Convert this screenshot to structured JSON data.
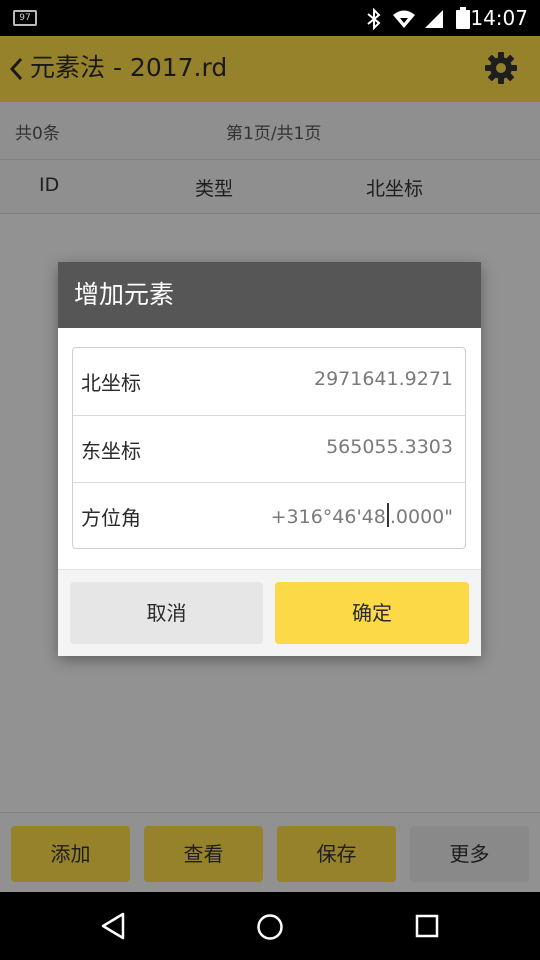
{
  "status_bar": {
    "notification_badge": "97",
    "time": "14:07",
    "icons": [
      "bluetooth-icon",
      "wifi-icon",
      "signal-icon",
      "battery-icon"
    ]
  },
  "app_bar": {
    "title": "元素法 - 2017.rd",
    "back_icon": "chevron-left-icon",
    "settings_icon": "gear-icon",
    "accent_color": "#fbd947"
  },
  "info_bar": {
    "record_count": "共0条",
    "pagination": "第1页/共1页"
  },
  "table": {
    "columns": [
      "ID",
      "类型",
      "北坐标"
    ]
  },
  "bottom_bar": {
    "buttons": [
      "添加",
      "查看",
      "保存",
      "更多"
    ]
  },
  "dialog": {
    "title": "增加元素",
    "fields": [
      {
        "label": "北坐标",
        "value": "2971641.9271"
      },
      {
        "label": "东坐标",
        "value": "565055.3303"
      },
      {
        "label": "方位角",
        "value_before_cursor": "+316°46'48",
        "value_after_cursor": ".0000\""
      }
    ],
    "cancel_label": "取消",
    "confirm_label": "确定"
  },
  "nav_bar": {
    "icons": [
      "back-icon",
      "home-icon",
      "recents-icon"
    ]
  }
}
